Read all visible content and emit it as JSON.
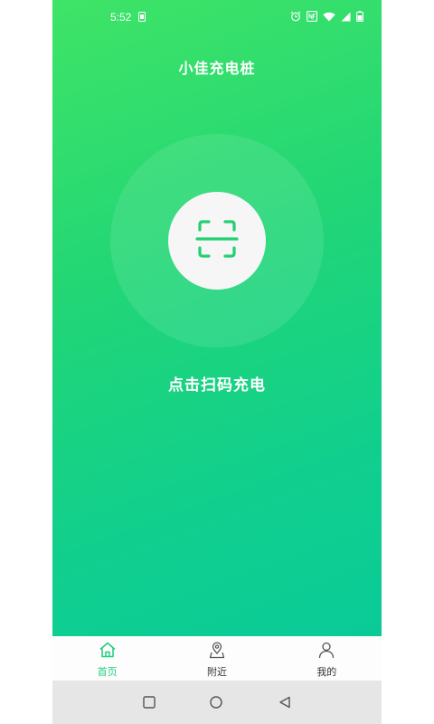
{
  "status_bar": {
    "time": "5:52",
    "icons": [
      "sim-card-icon",
      "alarm-icon",
      "nfc-icon",
      "wifi-icon",
      "signal-icon",
      "battery-icon"
    ]
  },
  "app": {
    "title": "小佳充电桩"
  },
  "scan": {
    "icon": "scan-icon",
    "label": "点击扫码充电"
  },
  "tabs": [
    {
      "label": "首页",
      "icon": "home-icon",
      "active": true
    },
    {
      "label": "附近",
      "icon": "location-pin-icon",
      "active": false
    },
    {
      "label": "我的",
      "icon": "user-icon",
      "active": false
    }
  ],
  "nav": {
    "buttons": [
      "recent-apps-icon",
      "home-circle-icon",
      "back-triangle-icon"
    ]
  },
  "colors": {
    "gradient_start": "#3fe466",
    "gradient_end": "#0acb98",
    "active_tab": "#1fcf7e",
    "scan_icon": "#22d072"
  }
}
